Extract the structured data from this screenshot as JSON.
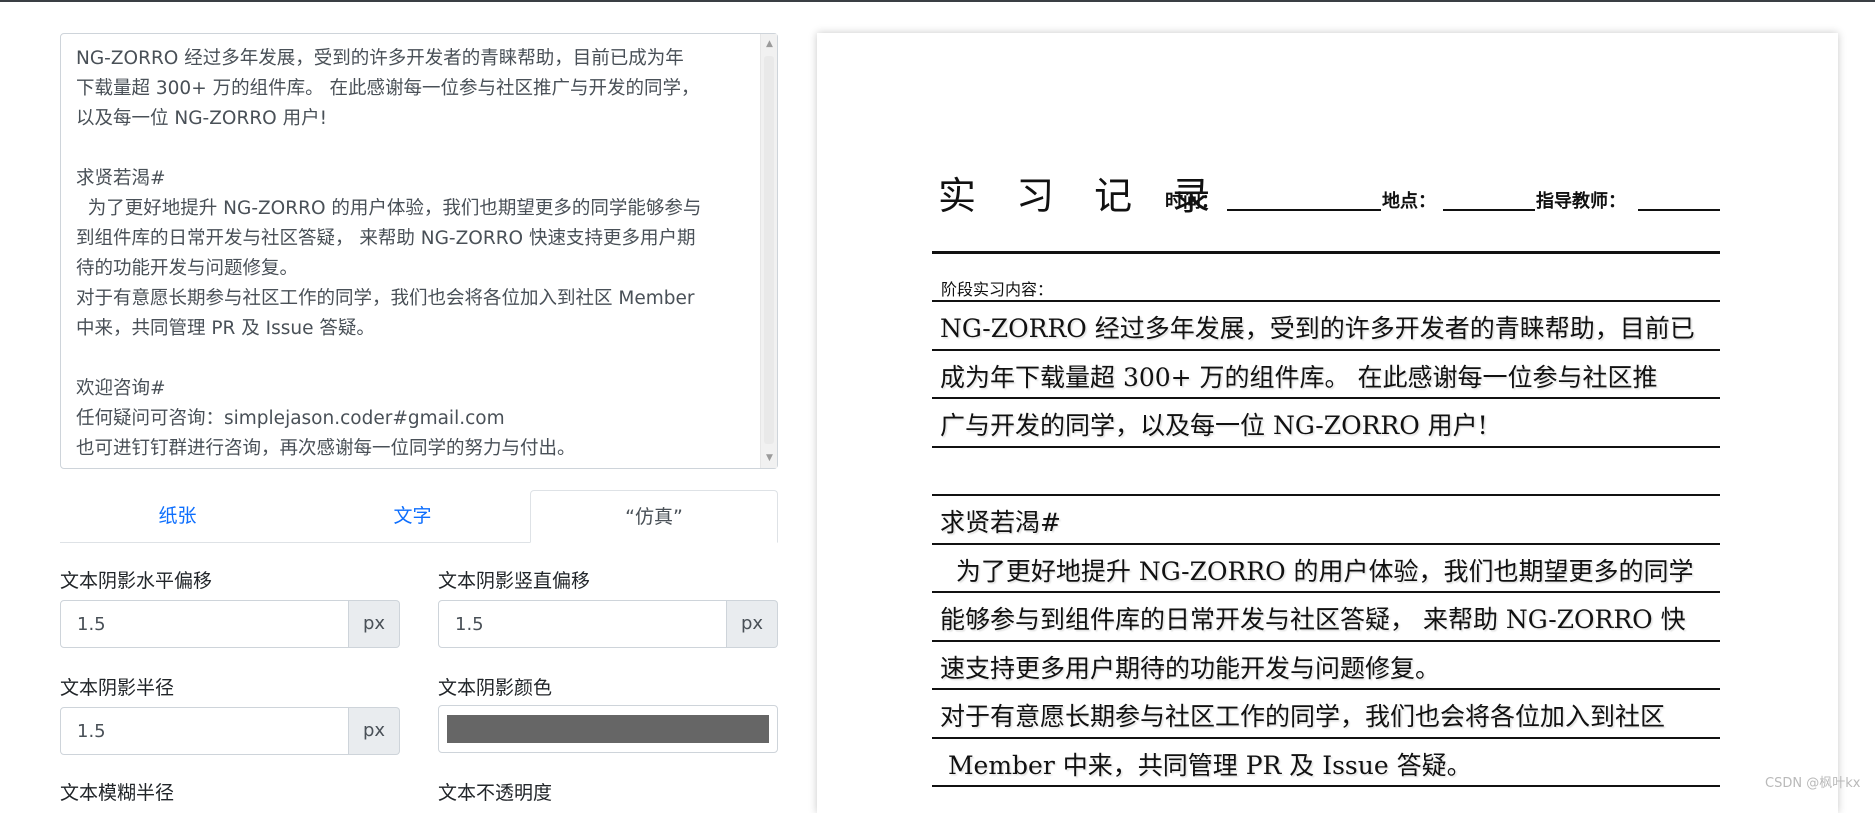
{
  "editor": {
    "text": "NG-ZORRO 经过多年发展，受到的许多开发者的青睐帮助，目前已成为年\n下载量超 300+ 万的组件库。 在此感谢每一位参与社区推广与开发的同学，\n以及每一位 NG-ZORRO 用户!\n\n求贤若渴#\n  为了更好地提升 NG-ZORRO 的用户体验，我们也期望更多的同学能够参与\n到组件库的日常开发与社区答疑， 来帮助 NG-ZORRO 快速支持更多用户期\n待的功能开发与问题修复。\n对于有意愿长期参与社区工作的同学，我们也会将各位加入到社区 Member\n中来，共同管理 PR 及 Issue 答疑。\n\n欢迎咨询#\n任何疑问可咨询：simplejason.coder#gmail.com\n也可进钉钉群进行咨询，再次感谢每一位同学的努力与付出。",
    "scroll_up": "▲",
    "scroll_down": "▼"
  },
  "tabs": [
    {
      "label": "纸张"
    },
    {
      "label": "文字"
    },
    {
      "label": "“仿真”"
    }
  ],
  "form": {
    "shadow_x": {
      "label": "文本阴影水平偏移",
      "value": "1.5",
      "unit": "px"
    },
    "shadow_y": {
      "label": "文本阴影竖直偏移",
      "value": "1.5",
      "unit": "px"
    },
    "shadow_radius": {
      "label": "文本阴影半径",
      "value": "1.5",
      "unit": "px"
    },
    "shadow_color": {
      "label": "文本阴影颜色",
      "value": "#666666"
    },
    "blur_radius": {
      "label": "文本模糊半径"
    },
    "opacity": {
      "label": "文本不透明度"
    }
  },
  "paper": {
    "title": "实 习 记 录",
    "time_label": "时间：",
    "place_label": "地点：",
    "teacher_label": "指导教师：",
    "section_label": "阶段实习内容：",
    "lines": [
      "NG-ZORRO 经过多年发展，受到的许多开发者的青睐帮助，目前已",
      "成为年下载量超 300+ 万的组件库。 在此感谢每一位参与社区推",
      "广与开发的同学，以及每一位 NG-ZORRO 用户!",
      "",
      "求贤若渴#",
      "  为了更好地提升 NG-ZORRO 的用户体验，我们也期望更多的同学",
      "能够参与到组件库的日常开发与社区答疑， 来帮助 NG-ZORRO 快",
      "速支持更多用户期待的功能开发与问题修复。",
      "对于有意愿长期参与社区工作的同学，我们也会将各位加入到社区",
      " Member 中来，共同管理 PR 及 Issue 答疑。"
    ]
  },
  "watermark": "CSDN @枫叶kx"
}
